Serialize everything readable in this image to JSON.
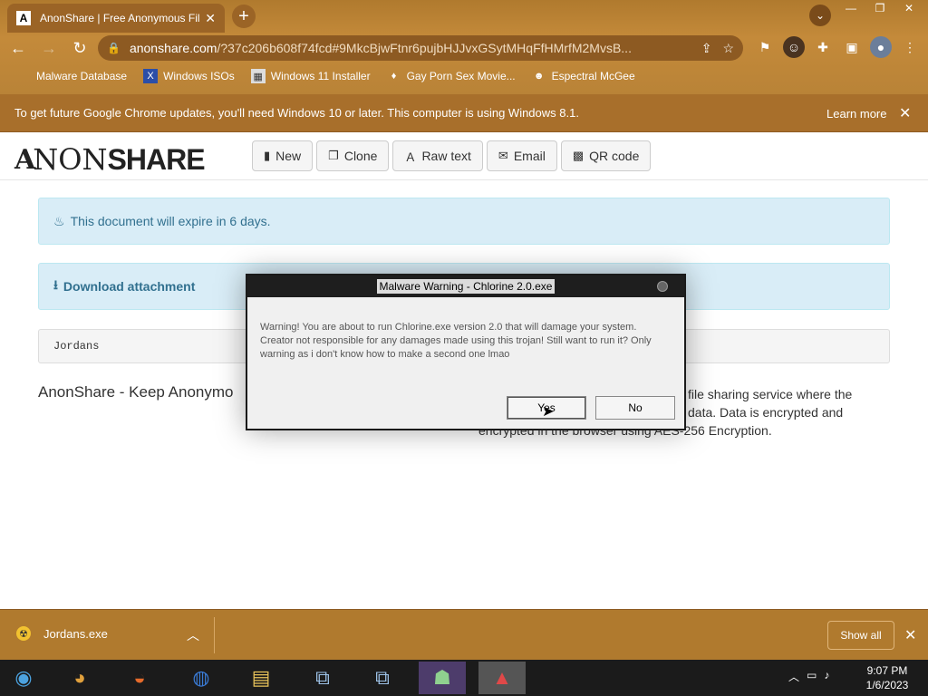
{
  "browser": {
    "tab_title": "AnonShare | Free Anonymous File...",
    "url_host": "anonshare.com",
    "url_rest": "/?37c206b608f74fcd#9MkcBjwFtnr6pujbHJJvxGSytMHqFfHMrfM2MvsB...",
    "bookmarks": [
      {
        "label": "Malware Database"
      },
      {
        "label": "Windows ISOs"
      },
      {
        "label": "Windows 11 Installer"
      },
      {
        "label": "Gay Porn Sex Movie..."
      },
      {
        "label": "Espectral McGee"
      }
    ],
    "infobar": {
      "message": "To get future Google Chrome updates, you'll need Windows 10 or later. This computer is using Windows 8.1.",
      "learn_more": "Learn more"
    }
  },
  "site": {
    "logo_a": "A",
    "logo_non": "NON",
    "logo_share": "SHARE",
    "buttons": [
      {
        "label": "New",
        "icon": "file-icon"
      },
      {
        "label": "Clone",
        "icon": "copy-icon"
      },
      {
        "label": "Raw text",
        "icon": "text-icon"
      },
      {
        "label": "Email",
        "icon": "envelope-icon"
      },
      {
        "label": "QR code",
        "icon": "qrcode-icon"
      }
    ],
    "expire_text": "This document will expire in 6 days.",
    "download_text": "Download attachment",
    "file_name": "Jordans",
    "heading": "AnonShare - Keep Anonymo",
    "desc_line1": "file sharing service where the",
    "desc_line2": "data. Data is encrypted and",
    "desc_line3": "encrypted in the browser using AES-256 Encryption."
  },
  "dialog": {
    "title": "Malware Warning - Chlorine 2.0.exe",
    "message": "Warning! You are about to run Chlorine.exe version 2.0 that will damage your system. Creator not responsible for any damages made using this trojan! Still want to run it? Only warning as i don't know how to make a second one lmao",
    "yes": "Yes",
    "no": "No"
  },
  "download_bar": {
    "file": "Jordans.exe",
    "show_all": "Show all"
  },
  "taskbar": {
    "time": "9:07 PM",
    "date": "1/6/2023"
  }
}
